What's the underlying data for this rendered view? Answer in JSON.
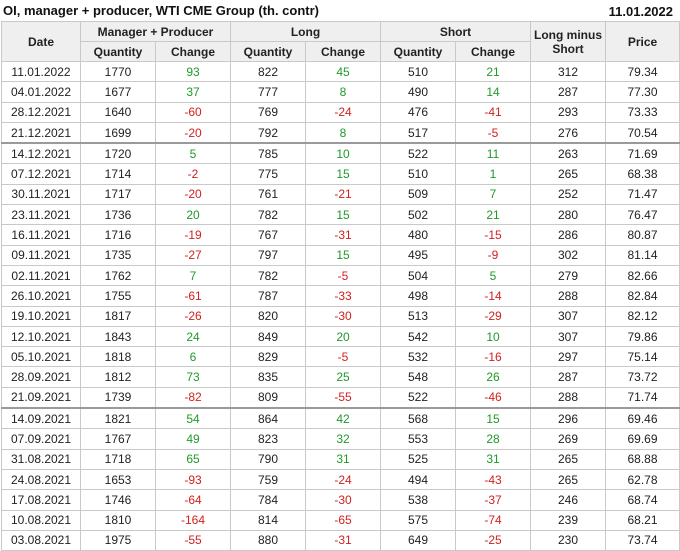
{
  "title": "OI, manager + producer, WTI CME Group (th. contr)",
  "date": "11.01.2022",
  "headers": {
    "date": "Date",
    "manager_producer": "Manager + Producer",
    "long": "Long",
    "short": "Short",
    "long_minus_short_line1": "Long minus",
    "long_minus_short_line2": "Short",
    "price": "Price",
    "quantity": "Quantity",
    "change": "Change"
  },
  "colors": {
    "positive": "#1f9a2a",
    "negative": "#d32020"
  },
  "rows": [
    [
      "11.01.2022",
      "1770",
      "93",
      "822",
      "45",
      "510",
      "21",
      "312",
      "79.34"
    ],
    [
      "04.01.2022",
      "1677",
      "37",
      "777",
      "8",
      "490",
      "14",
      "287",
      "77.30"
    ],
    [
      "28.12.2021",
      "1640",
      "-60",
      "769",
      "-24",
      "476",
      "-41",
      "293",
      "73.33"
    ],
    [
      "21.12.2021",
      "1699",
      "-20",
      "792",
      "8",
      "517",
      "-5",
      "276",
      "70.54"
    ],
    [
      "14.12.2021",
      "1720",
      "5",
      "785",
      "10",
      "522",
      "11",
      "263",
      "71.69"
    ],
    [
      "07.12.2021",
      "1714",
      "-2",
      "775",
      "15",
      "510",
      "1",
      "265",
      "68.38"
    ],
    [
      "30.11.2021",
      "1717",
      "-20",
      "761",
      "-21",
      "509",
      "7",
      "252",
      "71.47"
    ],
    [
      "23.11.2021",
      "1736",
      "20",
      "782",
      "15",
      "502",
      "21",
      "280",
      "76.47"
    ],
    [
      "16.11.2021",
      "1716",
      "-19",
      "767",
      "-31",
      "480",
      "-15",
      "286",
      "80.87"
    ],
    [
      "09.11.2021",
      "1735",
      "-27",
      "797",
      "15",
      "495",
      "-9",
      "302",
      "81.14"
    ],
    [
      "02.11.2021",
      "1762",
      "7",
      "782",
      "-5",
      "504",
      "5",
      "279",
      "82.66"
    ],
    [
      "26.10.2021",
      "1755",
      "-61",
      "787",
      "-33",
      "498",
      "-14",
      "288",
      "82.84"
    ],
    [
      "19.10.2021",
      "1817",
      "-26",
      "820",
      "-30",
      "513",
      "-29",
      "307",
      "82.12"
    ],
    [
      "12.10.2021",
      "1843",
      "24",
      "849",
      "20",
      "542",
      "10",
      "307",
      "79.86"
    ],
    [
      "05.10.2021",
      "1818",
      "6",
      "829",
      "-5",
      "532",
      "-16",
      "297",
      "75.14"
    ],
    [
      "28.09.2021",
      "1812",
      "73",
      "835",
      "25",
      "548",
      "26",
      "287",
      "73.72"
    ],
    [
      "21.09.2021",
      "1739",
      "-82",
      "809",
      "-55",
      "522",
      "-46",
      "288",
      "71.74"
    ],
    [
      "14.09.2021",
      "1821",
      "54",
      "864",
      "42",
      "568",
      "15",
      "296",
      "69.46"
    ],
    [
      "07.09.2021",
      "1767",
      "49",
      "823",
      "32",
      "553",
      "28",
      "269",
      "69.69"
    ],
    [
      "31.08.2021",
      "1718",
      "65",
      "790",
      "31",
      "525",
      "31",
      "265",
      "68.88"
    ],
    [
      "24.08.2021",
      "1653",
      "-93",
      "759",
      "-24",
      "494",
      "-43",
      "265",
      "62.78"
    ],
    [
      "17.08.2021",
      "1746",
      "-64",
      "784",
      "-30",
      "538",
      "-37",
      "246",
      "68.74"
    ],
    [
      "10.08.2021",
      "1810",
      "-164",
      "814",
      "-65",
      "575",
      "-74",
      "239",
      "68.21"
    ],
    [
      "03.08.2021",
      "1975",
      "-55",
      "880",
      "-31",
      "649",
      "-25",
      "230",
      "73.74"
    ]
  ]
}
